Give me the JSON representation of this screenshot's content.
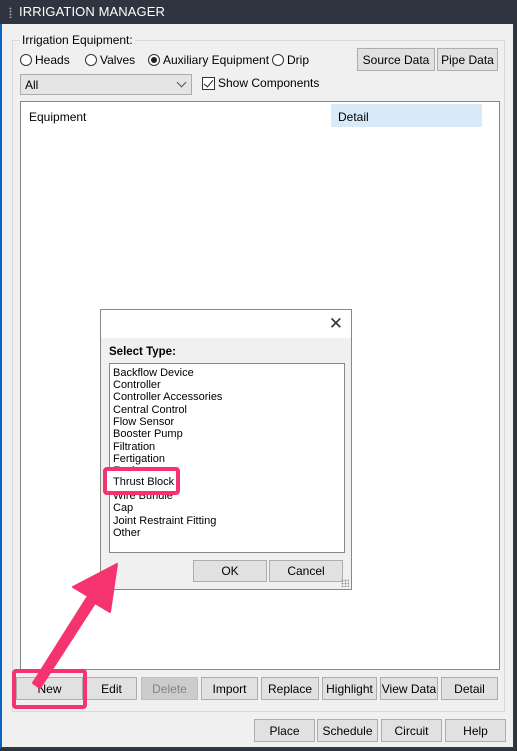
{
  "window": {
    "title": "IRRIGATION MANAGER"
  },
  "equipment_group": {
    "label": "Irrigation Equipment:",
    "radios": [
      {
        "label": "Heads",
        "selected": false
      },
      {
        "label": "Valves",
        "selected": false
      },
      {
        "label": "Auxiliary Equipment",
        "selected": true
      },
      {
        "label": "Drip",
        "selected": false
      }
    ],
    "source_data_label": "Source Data",
    "pipe_data_label": "Pipe Data",
    "filter_value": "All",
    "show_components_label": "Show Components",
    "show_components_checked": true
  },
  "list": {
    "columns": [
      "Equipment",
      "Detail"
    ]
  },
  "dialog": {
    "label": "Select Type:",
    "items": [
      "Backflow Device",
      "Controller",
      "Controller Accessories",
      "Central Control",
      "Flow Sensor",
      "Booster Pump",
      "Filtration",
      "Fertigation",
      "Enclosure",
      "Thrust Block",
      "Wire Bundle",
      "Cap",
      "Joint Restraint Fitting",
      "Other"
    ],
    "highlighted_item": "Thrust Block",
    "ok_label": "OK",
    "cancel_label": "Cancel"
  },
  "action_buttons": [
    {
      "label": "New",
      "enabled": true
    },
    {
      "label": "Edit",
      "enabled": true
    },
    {
      "label": "Delete",
      "enabled": false
    },
    {
      "label": "Import",
      "enabled": true
    },
    {
      "label": "Replace",
      "enabled": true
    },
    {
      "label": "Highlight",
      "enabled": true
    },
    {
      "label": "View Data",
      "enabled": true
    },
    {
      "label": "Detail",
      "enabled": true
    }
  ],
  "footer_buttons": [
    {
      "label": "Place"
    },
    {
      "label": "Schedule"
    },
    {
      "label": "Circuit"
    },
    {
      "label": "Help"
    }
  ],
  "annotation": {
    "color": "#f5336e"
  }
}
